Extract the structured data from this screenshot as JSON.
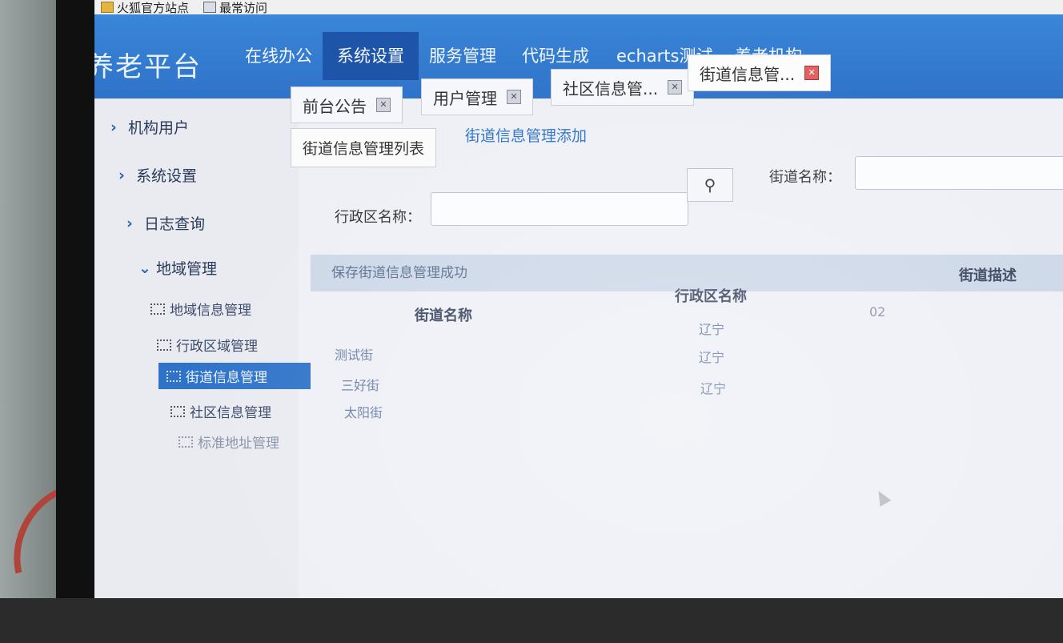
{
  "bookmarks": [
    {
      "label": "火狐官方站点",
      "icon": "folder-icon"
    },
    {
      "label": "最常访问",
      "icon": "page-icon"
    }
  ],
  "brand": "养老平台",
  "nav": [
    "在线办公",
    "系统设置",
    "服务管理",
    "代码生成",
    "echarts测试",
    "养老机构"
  ],
  "nav_active_index": 1,
  "sidebar": {
    "groups": [
      "机构用户",
      "系统设置",
      "日志查询",
      "地域管理"
    ],
    "items": [
      "地域信息管理",
      "行政区域管理",
      "街道信息管理",
      "社区信息管理",
      "标准地址管理"
    ]
  },
  "tabs": [
    "前台公告",
    "用户管理",
    "社区信息管...",
    "街道信息管..."
  ],
  "subtabs": {
    "list": "街道信息管理列表",
    "add": "街道信息管理添加"
  },
  "search": {
    "street_label": "街道名称：",
    "district_label": "行政区名称："
  },
  "message": "保存街道信息管理成功",
  "table": {
    "headers": [
      "街道名称",
      "行政区名称",
      "街道描述"
    ],
    "rows": [
      {
        "street": "",
        "district": "辽宁",
        "desc": "02"
      },
      {
        "street": "测试街",
        "district": "辽宁",
        "desc": ""
      },
      {
        "street": "三好街",
        "district": "辽宁",
        "desc": ""
      },
      {
        "street": "太阳街",
        "district": "",
        "desc": ""
      }
    ]
  },
  "colors": {
    "nav": "#2f73c9",
    "nav_active": "#1f55a8",
    "close_active": "#e06363"
  }
}
